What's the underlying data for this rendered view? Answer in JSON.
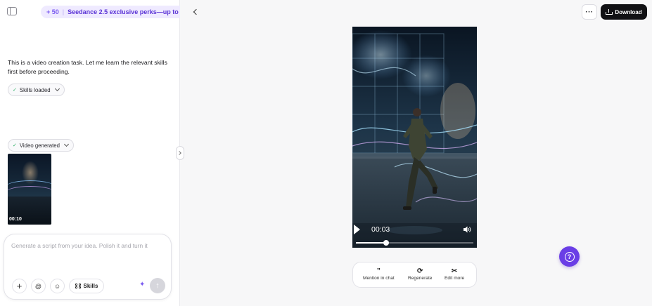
{
  "promo": {
    "credits": "+ 50",
    "text": "Seedance 2.5 exclusive perks—up to"
  },
  "chat": {
    "message": "This is a video creation task. Let me learn the relevant skills first before proceeding.",
    "skills_chip": "Skills loaded",
    "video_chip": "Video generated",
    "thumbnail_duration": "00:10"
  },
  "composer": {
    "placeholder": "Generate a script from your idea. Polish it and turn it",
    "skills_label": "Skills"
  },
  "toolbar": {
    "more_label": "···",
    "download_label": "Download"
  },
  "player": {
    "current_time": "00:03",
    "progress": 0.26
  },
  "actions": {
    "mention": "Mention in chat",
    "regenerate": "Regenerate",
    "edit_more": "Edit more"
  },
  "help": {
    "label": "?"
  },
  "colors": {
    "accent": "#6a3ee6",
    "promo_bg": "#efeaff",
    "promo_text": "#5b34d6",
    "download_bg": "#111114"
  },
  "icons": [
    "sidebar-toggle-icon",
    "check-icon",
    "chevron-down-icon",
    "plus-icon",
    "at-icon",
    "emoji-icon",
    "skills-grid-icon",
    "sparkle-icon",
    "arrow-up-icon",
    "chevron-left-icon",
    "download-icon",
    "play-icon",
    "volume-icon",
    "quote-icon",
    "refresh-icon",
    "scissors-icon",
    "help-icon"
  ]
}
